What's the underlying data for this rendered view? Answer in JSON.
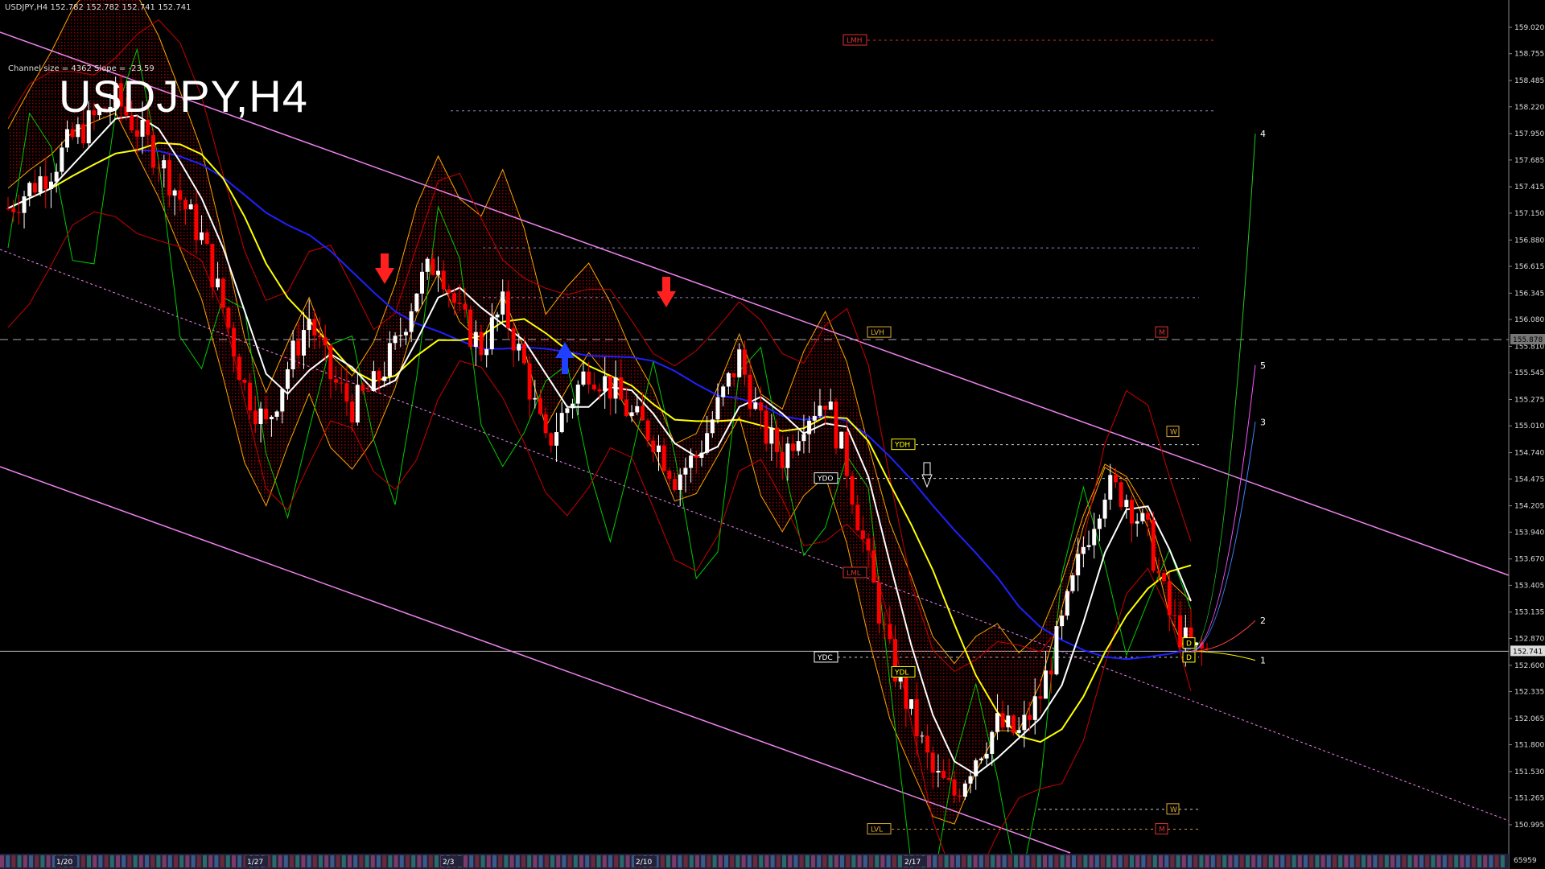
{
  "header": {
    "symbol_line": "USDJPY,H4",
    "ohlc": "152.782 152.782 152.741 152.741"
  },
  "channel_info": "Channel size = 4362 Slope = -23.59",
  "big_title": "USDJPY,H4",
  "colors": {
    "background": "#000000",
    "bull_candle": "#ffffff",
    "bear_candle": "#ff0000",
    "channel": "#ee82ee",
    "ma_yellow": "#ffff00",
    "ma_blue": "#2020ff",
    "ma_white": "#ffffff",
    "green_line": "#00cc00",
    "cloud_orange": "#ffa500",
    "cloud_red": "#cc0000",
    "cloud_blue": "#3050ff"
  },
  "chart_data": {
    "type": "line",
    "symbol": "USDJPY",
    "timeframe": "H4",
    "ylim": [
      150.8,
      159.2
    ],
    "y_ticks": [
      "159.020",
      "158.755",
      "158.485",
      "158.220",
      "157.950",
      "157.685",
      "157.415",
      "157.150",
      "156.880",
      "156.615",
      "156.345",
      "156.080",
      "155.810",
      "155.545",
      "155.275",
      "155.010",
      "154.740",
      "154.475",
      "154.205",
      "153.940",
      "153.670",
      "153.405",
      "153.135",
      "152.870",
      "152.600",
      "152.335",
      "152.065",
      "151.800",
      "151.530",
      "151.265",
      "150.995"
    ],
    "x_ticks": [
      "1/20",
      "1/27",
      "2/3",
      "2/10",
      "2/17"
    ],
    "current_price": "152.741",
    "marked_price": "155.878",
    "bottom_value": "65959",
    "series": [
      {
        "values": [
          157.2,
          157.4,
          157.6,
          157.9,
          158.1,
          158.3,
          158.0,
          157.7,
          157.3,
          156.9,
          156.2,
          155.4,
          155.0,
          155.6,
          156.1,
          155.5,
          155.2,
          155.4,
          155.8,
          156.4,
          156.7,
          156.1,
          155.8,
          156.2,
          155.6,
          154.8,
          155.2,
          155.6,
          155.4,
          155.1,
          154.9,
          154.5,
          154.7,
          155.2,
          155.7,
          155.0,
          154.7,
          155.1,
          155.3,
          154.6,
          153.6,
          152.7,
          152.1,
          151.5,
          151.3,
          151.7,
          152.0,
          151.9,
          152.3,
          153.0,
          153.8,
          154.4,
          154.3,
          153.9,
          153.1,
          152.74
        ]
      }
    ],
    "labels": {
      "levels": [
        "LMH",
        "LVH",
        "LML",
        "LVL",
        "YDH",
        "YDO",
        "YDC",
        "YDL",
        "M",
        "W",
        "D"
      ],
      "projection_numbers": [
        "1",
        "2",
        "3",
        "4",
        "5"
      ]
    }
  }
}
